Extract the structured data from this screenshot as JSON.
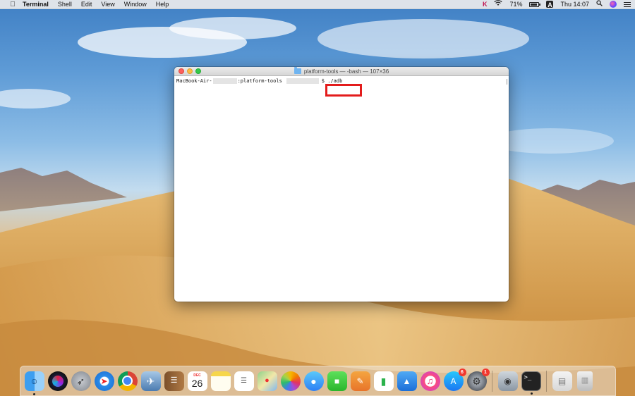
{
  "menubar": {
    "app_name": "Terminal",
    "items": [
      "Shell",
      "Edit",
      "View",
      "Window",
      "Help"
    ],
    "battery": "71%",
    "input_source": "A",
    "clock": "Thu 14:07"
  },
  "terminal": {
    "title": "platform-tools — -bash — 107×36",
    "prompt_host": "MacBook-Air-",
    "prompt_dir": ":platform-tools",
    "prompt_cmd": "$ ./adb"
  },
  "dock": {
    "calendar_month": "DEC",
    "calendar_day": "26",
    "appstore_badge": "6",
    "prefs_badge": "1",
    "terminal_glyph": ">_"
  },
  "colors": {
    "highlight": "#e31c1c",
    "menubar_bg": "#ececec"
  }
}
